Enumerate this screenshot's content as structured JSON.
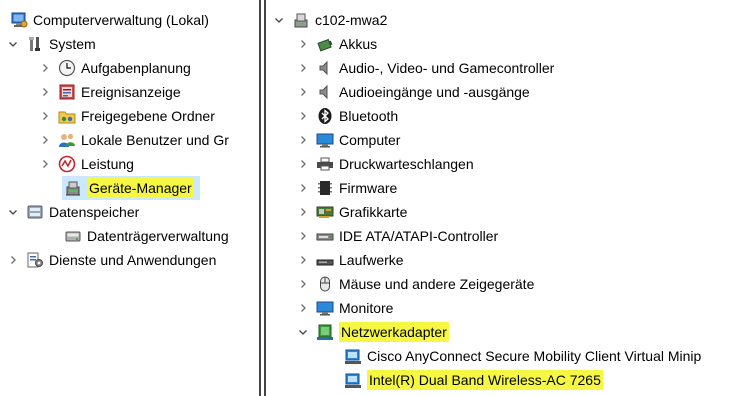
{
  "left_tree": {
    "root": {
      "label": "Computerverwaltung (Lokal)",
      "icon": "computer-management-icon"
    },
    "system": {
      "label": "System",
      "icon": "tools-icon"
    },
    "system_items": [
      {
        "label": "Aufgabenplanung",
        "icon": "clock-icon"
      },
      {
        "label": "Ereignisanzeige",
        "icon": "event-viewer-icon"
      },
      {
        "label": "Freigegebene Ordner",
        "icon": "shared-folder-icon"
      },
      {
        "label": "Lokale Benutzer und Gr",
        "icon": "users-icon"
      },
      {
        "label": "Leistung",
        "icon": "performance-icon"
      },
      {
        "label": "Geräte-Manager",
        "icon": "device-manager-icon",
        "selected": true,
        "highlighted": true
      }
    ],
    "storage": {
      "label": "Datenspeicher",
      "icon": "storage-icon"
    },
    "storage_items": [
      {
        "label": "Datenträgerverwaltung",
        "icon": "disk-management-icon"
      }
    ],
    "services": {
      "label": "Dienste und Anwendungen",
      "icon": "services-icon"
    }
  },
  "right_tree": {
    "root": {
      "label": "c102-mwa2",
      "icon": "computer-icon"
    },
    "categories": [
      {
        "label": "Akkus",
        "icon": "battery-icon"
      },
      {
        "label": "Audio-, Video- und Gamecontroller",
        "icon": "speaker-icon"
      },
      {
        "label": "Audioeingänge und -ausgänge",
        "icon": "speaker-icon"
      },
      {
        "label": "Bluetooth",
        "icon": "bluetooth-icon"
      },
      {
        "label": "Computer",
        "icon": "monitor-icon"
      },
      {
        "label": "Druckwarteschlangen",
        "icon": "printer-icon"
      },
      {
        "label": "Firmware",
        "icon": "firmware-icon"
      },
      {
        "label": "Grafikkarte",
        "icon": "graphics-card-icon"
      },
      {
        "label": "IDE ATA/ATAPI-Controller",
        "icon": "ide-controller-icon"
      },
      {
        "label": "Laufwerke",
        "icon": "drive-icon"
      },
      {
        "label": "Mäuse und andere Zeigegeräte",
        "icon": "mouse-icon"
      },
      {
        "label": "Monitore",
        "icon": "monitor-icon"
      },
      {
        "label": "Netzwerkadapter",
        "icon": "network-adapter-icon",
        "expanded": true,
        "highlighted": true
      }
    ],
    "network_adapters": [
      {
        "label": "Cisco AnyConnect Secure Mobility Client Virtual Minip",
        "icon": "network-adapter-icon"
      },
      {
        "label": "Intel(R) Dual Band Wireless-AC 7265",
        "icon": "network-adapter-icon",
        "highlighted": true
      }
    ]
  },
  "colors": {
    "highlight": "#f6f742",
    "selection": "#cce8ff",
    "chevron": "#6d6d6d"
  }
}
